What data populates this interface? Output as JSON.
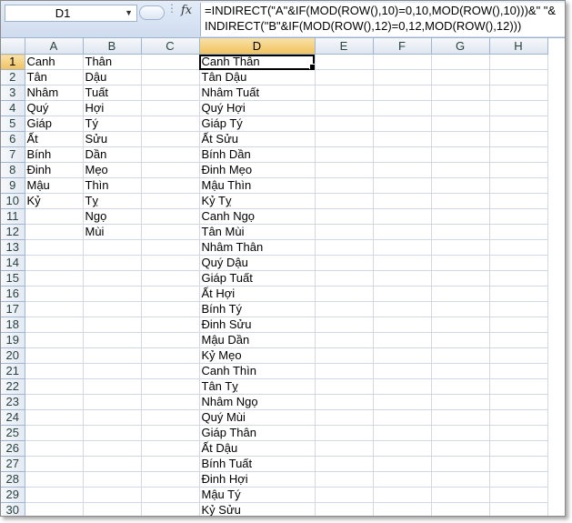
{
  "name_box": {
    "value": "D1",
    "arrow": "▼"
  },
  "fx_label": "fx",
  "formula": "=INDIRECT(\"A\"&IF(MOD(ROW(),10)=0,10,MOD(ROW(),10)))&\" \"&\nINDIRECT(\"B\"&IF(MOD(ROW(),12)=0,12,MOD(ROW(),12)))",
  "active_cell": "D1",
  "columns": [
    "A",
    "B",
    "C",
    "D",
    "E",
    "F",
    "G",
    "H"
  ],
  "column_a": [
    "Canh",
    "Tân",
    "Nhâm",
    "Quý",
    "Giáp",
    "Ất",
    "Bính",
    "Đinh",
    "Mậu",
    "Kỷ"
  ],
  "column_b": [
    "Thân",
    "Dậu",
    "Tuất",
    "Hợi",
    "Tý",
    "Sửu",
    "Dần",
    "Mẹo",
    "Thìn",
    "Tỵ",
    "Ngọ",
    "Mùi"
  ],
  "column_d": [
    "Canh Thân",
    "Tân Dậu",
    "Nhâm Tuất",
    "Quý Hợi",
    "Giáp Tý",
    "Ất Sửu",
    "Bính Dần",
    "Đinh Mẹo",
    "Mậu Thìn",
    "Kỷ Tỵ",
    "Canh Ngọ",
    "Tân Mùi",
    "Nhâm Thân",
    "Quý Dậu",
    "Giáp Tuất",
    "Ất Hợi",
    "Bính Tý",
    "Đinh Sửu",
    "Mậu Dần",
    "Kỷ Mẹo",
    "Canh Thìn",
    "Tân Tỵ",
    "Nhâm Ngọ",
    "Quý Mùi",
    "Giáp Thân",
    "Ất Dậu",
    "Bính Tuất",
    "Đinh Hợi",
    "Mậu Tý",
    "Kỷ Sửu"
  ],
  "row_numbers": [
    "1",
    "2",
    "3",
    "4",
    "5",
    "6",
    "7",
    "8",
    "9",
    "10",
    "11",
    "12",
    "13",
    "14",
    "15",
    "16",
    "17",
    "18",
    "19",
    "20",
    "21",
    "22",
    "23",
    "24",
    "25",
    "26",
    "27",
    "28",
    "29",
    "30"
  ]
}
